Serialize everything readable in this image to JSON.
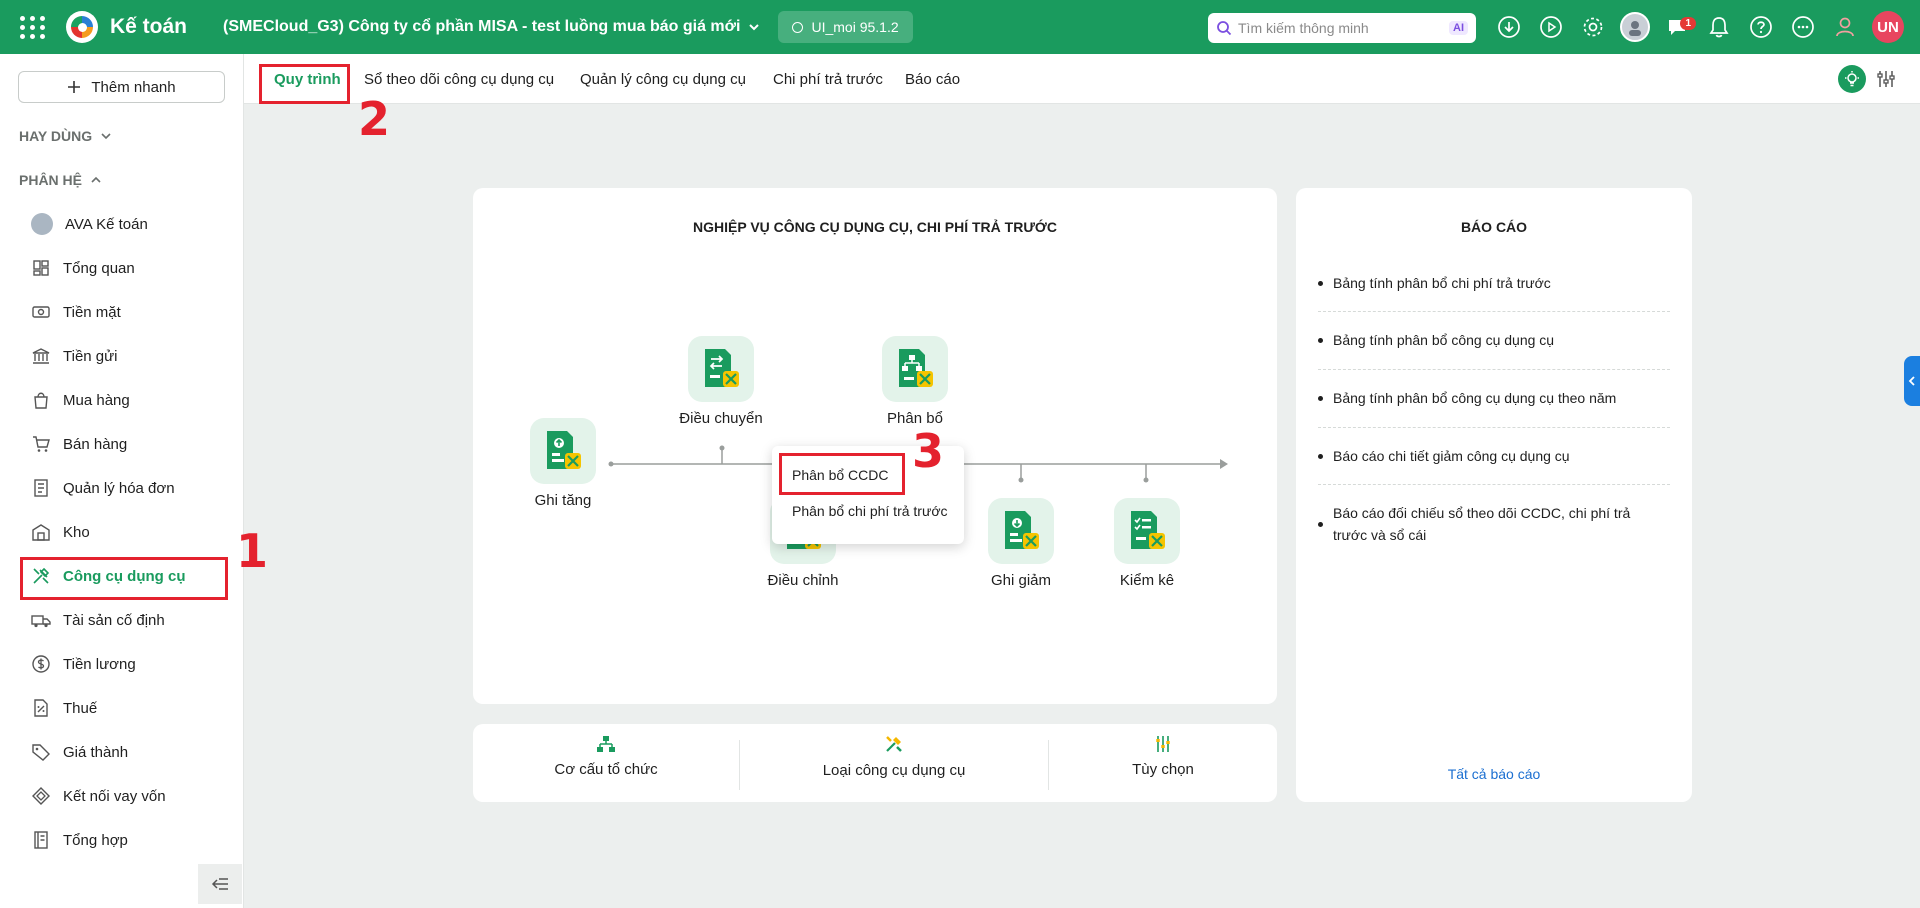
{
  "app": {
    "name": "Kế toán",
    "company": "(SMECloud_G3) Công ty cổ phần MISA - test luồng mua báo giá mới",
    "version": "UI_moi 95.1.2"
  },
  "search": {
    "placeholder": "Tìm kiếm thông minh",
    "ai_label": "AI"
  },
  "header": {
    "notification_count": "1",
    "user_initials": "UN",
    "brand_color": "#1a9b5e"
  },
  "sidebar": {
    "quick_add": "Thêm nhanh",
    "frequent_label": "HAY DÙNG",
    "modules_label": "PHÂN HỆ",
    "items": [
      {
        "label": "AVA Kế toán",
        "icon": "ava-avatar-icon"
      },
      {
        "label": "Tổng quan",
        "icon": "dashboard-icon"
      },
      {
        "label": "Tiền mặt",
        "icon": "cash-icon"
      },
      {
        "label": "Tiền gửi",
        "icon": "bank-icon"
      },
      {
        "label": "Mua hàng",
        "icon": "shopping-bag-icon"
      },
      {
        "label": "Bán hàng",
        "icon": "cart-icon"
      },
      {
        "label": "Quản lý hóa đơn",
        "icon": "invoice-icon"
      },
      {
        "label": "Kho",
        "icon": "warehouse-icon"
      },
      {
        "label": "Công cụ dụng cụ",
        "icon": "tools-icon",
        "active": true
      },
      {
        "label": "Tài sản cố định",
        "icon": "truck-icon"
      },
      {
        "label": "Tiền lương",
        "icon": "dollar-icon"
      },
      {
        "label": "Thuế",
        "icon": "tax-icon"
      },
      {
        "label": "Giá thành",
        "icon": "price-tag-icon"
      },
      {
        "label": "Kết nối vay vốn",
        "icon": "loan-icon"
      },
      {
        "label": "Tổng hợp",
        "icon": "ledger-icon"
      }
    ]
  },
  "tabs": [
    {
      "label": "Quy trình",
      "active": true
    },
    {
      "label": "Sổ theo dõi công cụ dụng cụ"
    },
    {
      "label": "Quản lý công cụ dụng cụ"
    },
    {
      "label": "Chi phí trả trước"
    },
    {
      "label": "Báo cáo"
    }
  ],
  "process": {
    "title": "NGHIỆP VỤ CÔNG CỤ DỤNG CỤ, CHI PHÍ TRẢ TRƯỚC",
    "nodes": {
      "ghi_tang": "Ghi tăng",
      "dieu_chuyen": "Điều chuyển",
      "phan_bo": "Phân bổ",
      "dieu_chinh": "Điều chỉnh",
      "ghi_giam": "Ghi giảm",
      "kiem_ke": "Kiểm kê"
    },
    "popup": [
      "Phân bổ CCDC",
      "Phân bổ chi phí trả trước"
    ]
  },
  "categories": [
    "Cơ cấu tổ chức",
    "Loại công cụ dụng cụ",
    "Tùy chọn"
  ],
  "reports": {
    "title": "BÁO CÁO",
    "items": [
      "Bảng tính phân bổ chi phí trả trước",
      "Bảng tính phân bổ công cụ dụng cụ",
      "Bảng tính phân bổ công cụ dụng cụ theo năm",
      "Báo cáo chi tiết giảm công cụ dụng cụ",
      "Báo cáo đối chiếu sổ theo dõi CCDC, chi phí trả trước và sổ cái"
    ],
    "all_link": "Tất cả báo cáo"
  },
  "annotations": [
    "1",
    "2",
    "3"
  ]
}
